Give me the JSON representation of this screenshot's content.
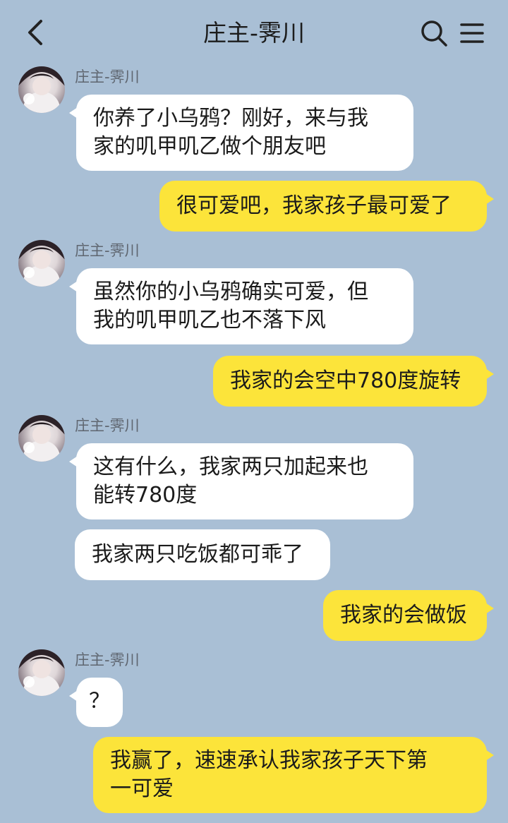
{
  "header": {
    "title": "庄主-霁川"
  },
  "messages": [
    {
      "sender": "庄主-霁川",
      "text": "你养了小乌鸦？刚好，来与我\n家的叽甲叽乙做个朋友吧"
    },
    {
      "text": "很可爱吧，我家孩子最可爱了"
    },
    {
      "sender": "庄主-霁川",
      "text": "虽然你的小乌鸦确实可爱，但\n我的叽甲叽乙也不落下风"
    },
    {
      "text": "我家的会空中780度旋转"
    },
    {
      "sender": "庄主-霁川",
      "text": "这有什么，我家两只加起来也\n能转780度"
    },
    {
      "text": "我家两只吃饭都可乖了"
    },
    {
      "text": "我家的会做饭"
    },
    {
      "sender": "庄主-霁川",
      "text": "？"
    },
    {
      "text": "我赢了，速速承认我家孩子天下第\n一可爱"
    }
  ],
  "colors": {
    "background": "#a9bfd5",
    "incoming_bubble": "#ffffff",
    "outgoing_bubble": "#fce43a"
  },
  "icons": {
    "back": "chevron-left-icon",
    "search": "search-icon",
    "menu": "menu-icon",
    "avatar": "contact-avatar"
  }
}
